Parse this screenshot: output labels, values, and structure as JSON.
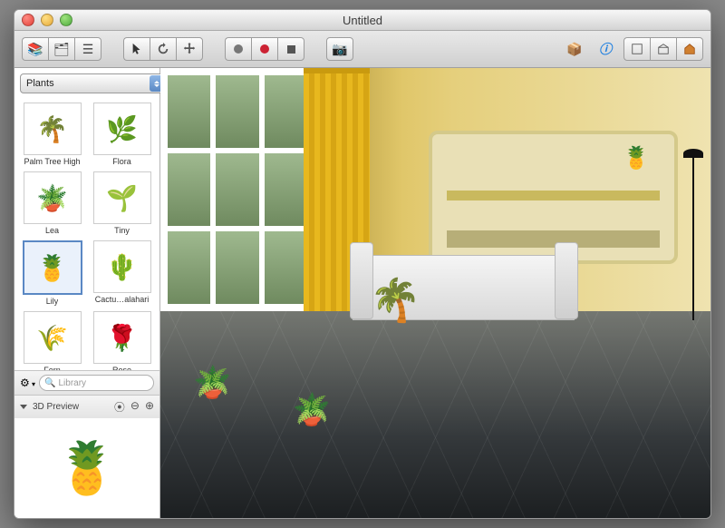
{
  "window": {
    "title": "Untitled"
  },
  "toolbar": {
    "left_group": [
      "library-toggle",
      "layers-toggle",
      "list-toggle"
    ],
    "tool_group": [
      "pointer",
      "rotate",
      "move"
    ],
    "capture_group": [
      "record",
      "record-alt",
      "stop"
    ],
    "camera": "camera",
    "right_group": [
      "package",
      "info",
      "view-2d",
      "view-elevation",
      "view-3d"
    ]
  },
  "sidebar": {
    "category_label": "Plants",
    "items": [
      {
        "label": "Palm Tree High",
        "glyph": "🌴",
        "selected": false
      },
      {
        "label": "Flora",
        "glyph": "🌿",
        "selected": false
      },
      {
        "label": "Lea",
        "glyph": "🪴",
        "selected": false
      },
      {
        "label": "Tiny",
        "glyph": "🌱",
        "selected": false
      },
      {
        "label": "Lily",
        "glyph": "🍍",
        "selected": true
      },
      {
        "label": "Cactu…alahari",
        "glyph": "🌵",
        "selected": false
      },
      {
        "label": "Fern",
        "glyph": "🌾",
        "selected": false
      },
      {
        "label": "Rose",
        "glyph": "🌹",
        "selected": false
      }
    ],
    "search_placeholder": "Library",
    "preview_label": "3D Preview",
    "preview_glyph": "🍍"
  }
}
